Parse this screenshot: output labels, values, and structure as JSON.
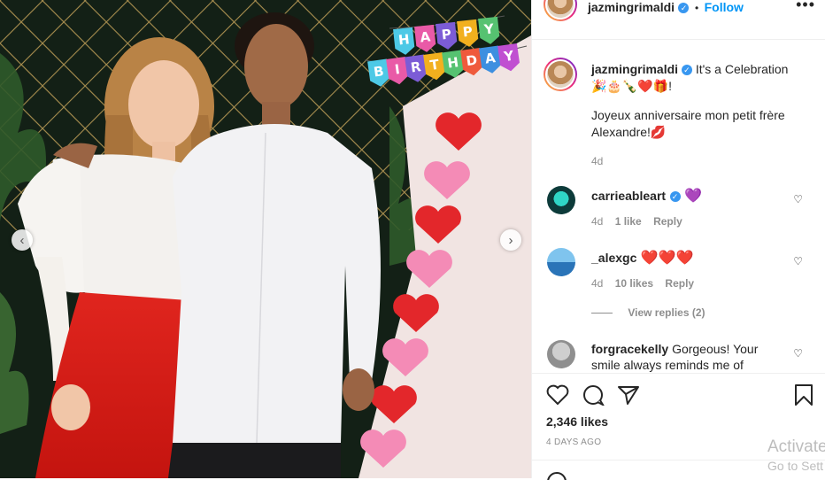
{
  "photo": {
    "banner_row1": "HAPPY",
    "banner_row2": "BIRTHDAY",
    "banner_colors": [
      "#4dc9e6",
      "#e95aa7",
      "#7c5cd6",
      "#f2b01e",
      "#56c271",
      "#ef5a3c",
      "#3d8fe0",
      "#c04fd1"
    ]
  },
  "header": {
    "username": "jazmingrimaldi",
    "verified_icon": "✓",
    "separator": "•",
    "follow_label": "Follow",
    "more_icon": "•••"
  },
  "caption": {
    "username": "jazmingrimaldi",
    "line1": "It's a Celebration",
    "emojis": "🎉🎂🍾❤️🎁!",
    "text": "Joyeux anniversaire mon petit frère Alexandre!💋",
    "age": "4d"
  },
  "comments": [
    {
      "user": "carrieableart",
      "text": "💜",
      "age": "4d",
      "likes": "1 like",
      "reply": "Reply"
    },
    {
      "user": "_alexgc",
      "text": "❤️❤️❤️",
      "age": "4d",
      "likes": "10 likes",
      "reply": "Reply"
    },
    {
      "user": "forgracekelly",
      "text": "Gorgeous! Your smile always reminds me of"
    }
  ],
  "view_replies": "View replies (2)",
  "likes": "2,346 likes",
  "posted": "4 DAYS AGO",
  "watermark": {
    "line1": "Activate",
    "line2": "Go to Sett"
  }
}
